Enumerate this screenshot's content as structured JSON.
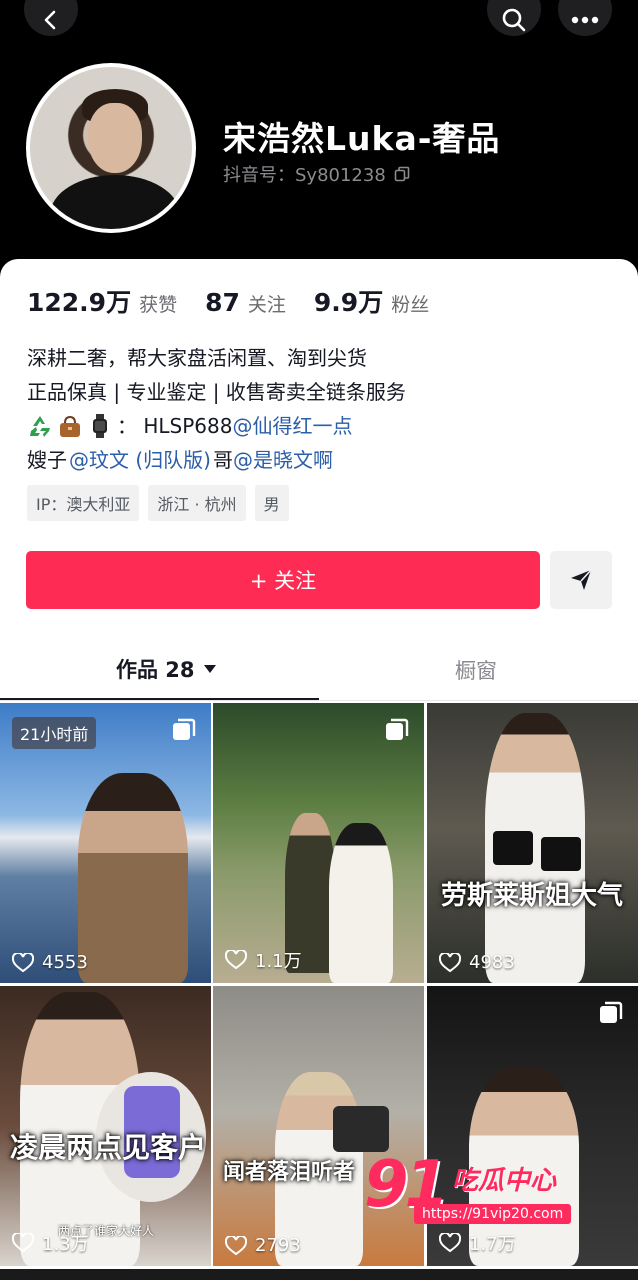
{
  "header": {
    "name": "宋浩然Luka-奢品",
    "douyin_id": "抖音号：Sy801238"
  },
  "stats": [
    {
      "value": "122.9万",
      "label": "获赞"
    },
    {
      "value": "87",
      "label": "关注"
    },
    {
      "value": "9.9万",
      "label": "粉丝"
    }
  ],
  "bio": {
    "line1": "深耕二奢，帮大家盘活闲置、淘到尖货",
    "line2": "正品保真 | 专业鉴定 | 收售寄卖全链条服务",
    "line3_text": "： HLSP688",
    "line3_mention": "@仙得红一点",
    "line4_prefix": "嫂子",
    "line4_mention1": "@玟文 (归队版)",
    "line4_middle": "哥",
    "line4_mention2": "@是晓文啊"
  },
  "tags": [
    "IP：澳大利亚",
    "浙江 · 杭州",
    "男"
  ],
  "actions": {
    "follow_label": "+ 关注"
  },
  "tabs": {
    "works_label": "作品 28",
    "window_label": "橱窗"
  },
  "videos": [
    {
      "likes": "4553",
      "badge": "21小时前",
      "caption": ""
    },
    {
      "likes": "1.1万",
      "caption": ""
    },
    {
      "likes": "4983",
      "caption": "劳斯莱斯姐大气"
    },
    {
      "likes": "1.3万",
      "caption": "凌晨两点见客户",
      "subcaption": "两点了谁家大好人"
    },
    {
      "likes": "2793",
      "caption": "闻者落泪听者"
    },
    {
      "likes": "1.7万",
      "caption": ""
    }
  ],
  "watermark": {
    "number": "91",
    "text": "吃瓜中心",
    "url": "https://91vip20.com"
  },
  "colors": {
    "accent": "#fe2c55",
    "mention": "#2b5ea8"
  }
}
